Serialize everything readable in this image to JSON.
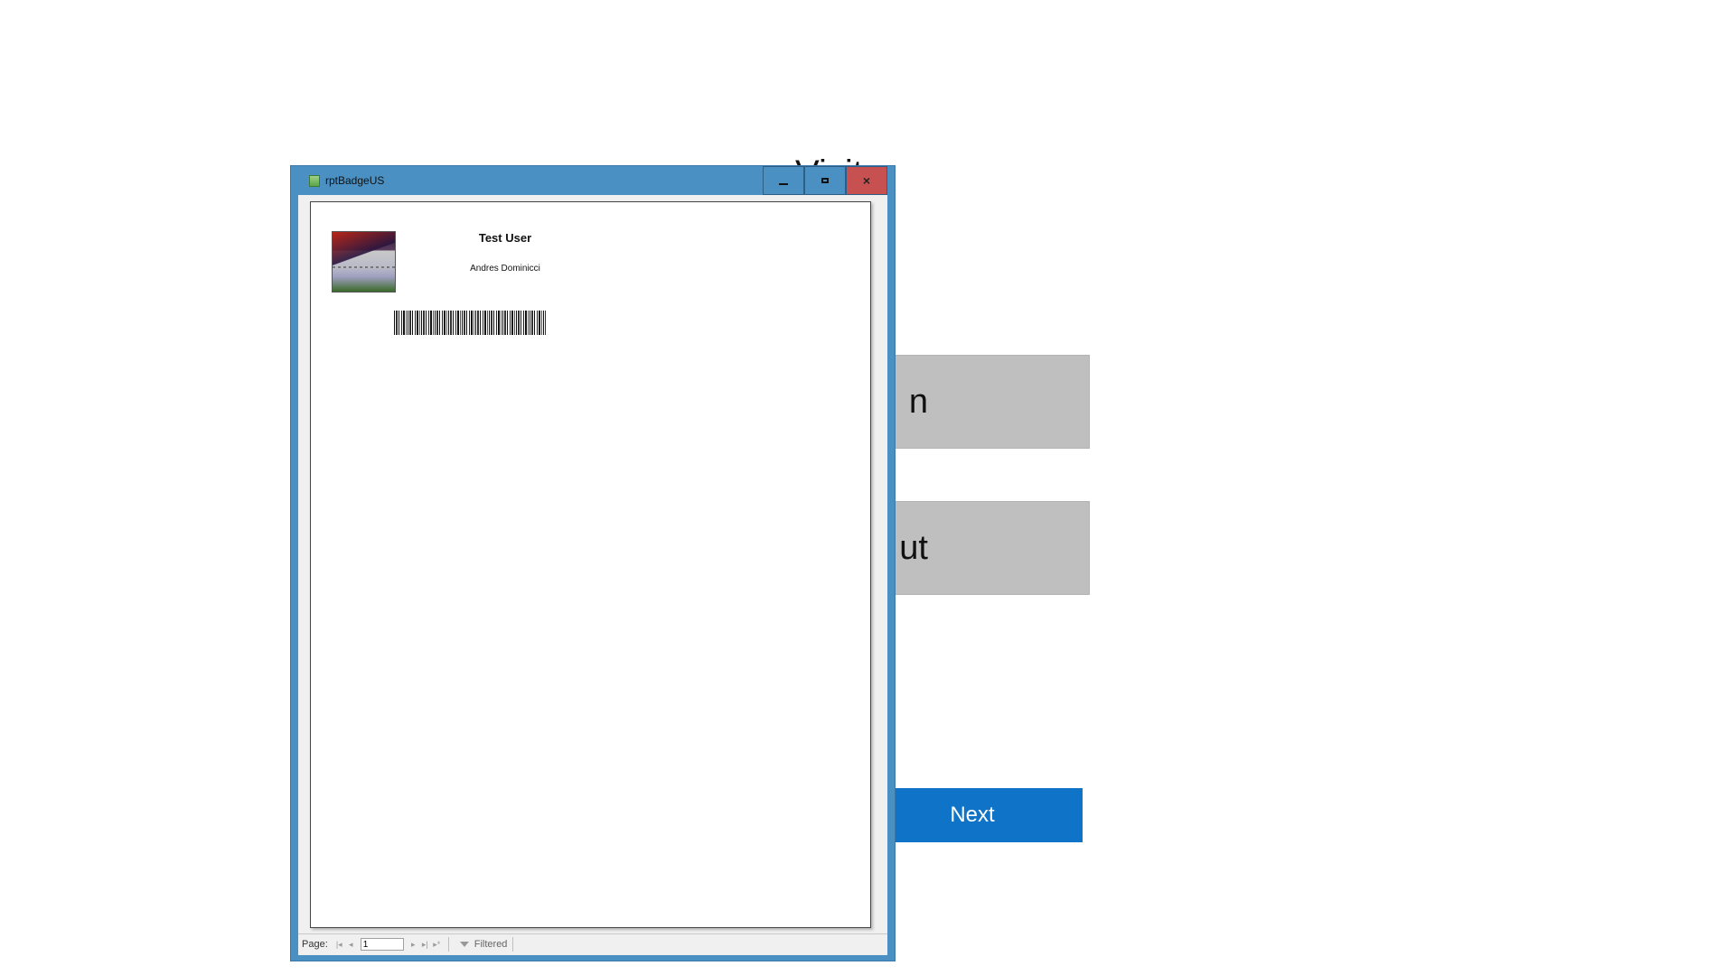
{
  "background_app": {
    "title": "Visitor",
    "options": [
      {
        "label": "n"
      },
      {
        "label": "ut"
      }
    ],
    "next_label": "Next"
  },
  "report_window": {
    "title": "rptBadgeUS",
    "buttons": {
      "minimize": "minimize-icon",
      "maximize": "maximize-icon",
      "close": "×"
    },
    "badge": {
      "visitor_name": "Test User",
      "host_name": "Andres Dominicci",
      "photo": "visitor-photo",
      "barcode": "visitor-barcode"
    },
    "statusbar": {
      "page_label": "Page:",
      "page_value": "1",
      "filter_label": "Filtered"
    }
  },
  "colors": {
    "window_frame": "#4a90c2",
    "close_button": "#c75050",
    "next_button": "#0f73c8",
    "option_button": "#bfbfbf"
  }
}
